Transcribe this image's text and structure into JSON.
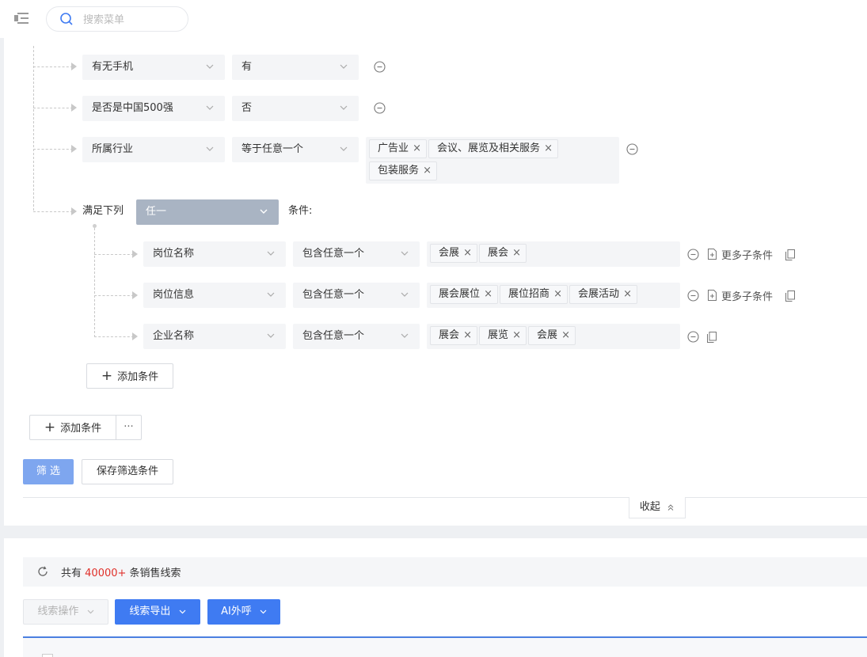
{
  "search": {
    "placeholder": "搜索菜单"
  },
  "conditions": [
    {
      "field": "有无手机",
      "operator": "有"
    },
    {
      "field": "是否是中国500强",
      "operator": "否"
    },
    {
      "field": "所属行业",
      "operator": "等于任意一个",
      "tags": [
        "广告业",
        "会议、展览及相关服务",
        "包装服务"
      ]
    }
  ],
  "group": {
    "prefix_label": "满足下列",
    "match_mode": "任一",
    "suffix_label": "条件:",
    "conditions": [
      {
        "field": "岗位名称",
        "operator": "包含任意一个",
        "tags": [
          "会展",
          "展会"
        ],
        "more_label": "更多子条件"
      },
      {
        "field": "岗位信息",
        "operator": "包含任意一个",
        "tags": [
          "展会展位",
          "展位招商",
          "会展活动"
        ],
        "more_label": "更多子条件"
      },
      {
        "field": "企业名称",
        "operator": "包含任意一个",
        "tags": [
          "展会",
          "展览",
          "会展"
        ]
      }
    ],
    "add_condition_label": "添加条件"
  },
  "toolbar": {
    "add_condition_label": "添加条件",
    "more_label": "···",
    "filter_label": "筛 选",
    "save_label": "保存筛选条件",
    "collapse_label": "收起"
  },
  "results": {
    "summary_prefix": "共有",
    "summary_count": "40000+",
    "summary_suffix": "条销售线索",
    "actions": {
      "lead_ops_label": "线索操作",
      "export_label": "线索导出",
      "ai_call_label": "AI外呼"
    }
  },
  "colors": {
    "primary": "#3f7bf2",
    "primary_light": "#7ea6ef",
    "count_red": "#e0302a",
    "group_select": "#a9b4c3"
  },
  "icons": [
    "menu-toggle-icon",
    "search-icon",
    "chevron-down-icon",
    "circle-minus-icon",
    "doc-add-icon",
    "copy-icon",
    "plus-icon",
    "refresh-icon",
    "chevron-up-icon"
  ]
}
